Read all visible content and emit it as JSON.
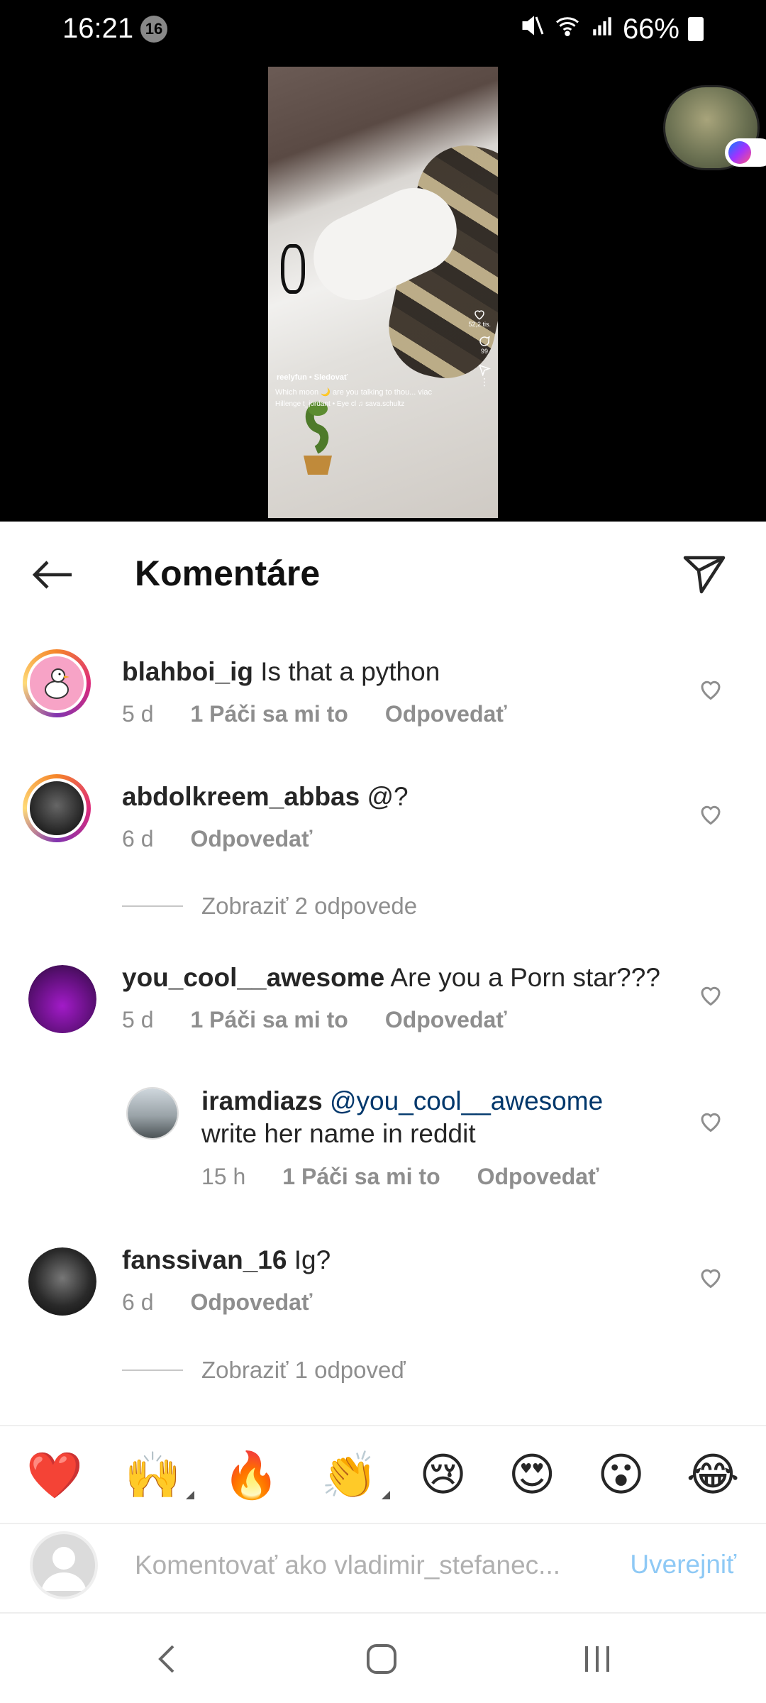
{
  "status_bar": {
    "time": "16:21",
    "notification_count": "16",
    "battery": "66%"
  },
  "video": {
    "likes": "52,2 tis.",
    "comments": "99",
    "account": "reelyfun • Sledovať",
    "caption": "Which moon 🌙 are you talking to thou... viac",
    "tags": "Hillenge   t_jordant • Eye cl   ♫ sava.schultz"
  },
  "header": {
    "title": "Komentáre"
  },
  "comments": [
    {
      "username": "blahboi_ig",
      "text": "Is that a python",
      "time": "5 d",
      "likes": "1 Páči sa mi to",
      "reply": "Odpovedať"
    },
    {
      "username": "abdolkreem_abbas",
      "text": "@?",
      "time": "6 d",
      "reply": "Odpovedať"
    },
    {
      "username": "you_cool__awesome",
      "text": "Are you a Porn star???",
      "time": "5 d",
      "likes": "1 Páči sa mi to",
      "reply": "Odpovedať"
    },
    {
      "username": "fanssivan_16",
      "text": "Ig?",
      "time": "6 d",
      "reply": "Odpovedať"
    }
  ],
  "reply": {
    "username": "iramdiazs",
    "mention": "@you_cool__awesome",
    "text": "write her name in reddit",
    "time": "15 h",
    "likes": "1 Páči sa mi to",
    "reply": "Odpovedať"
  },
  "view_replies_1": "Zobraziť 2 odpovede",
  "view_replies_2": "Zobraziť 1 odpoveď",
  "emojis": [
    "❤️",
    "🙌",
    "🔥",
    "👏",
    "😢",
    "😍",
    "😮",
    "😂"
  ],
  "composer": {
    "placeholder": "Komentovať ako vladimir_stefanec...",
    "post_label": "Uverejniť"
  },
  "colors": {
    "accent_link": "#00376b",
    "post_disabled": "#8ec9f5",
    "meta_gray": "#8e8e8e"
  }
}
